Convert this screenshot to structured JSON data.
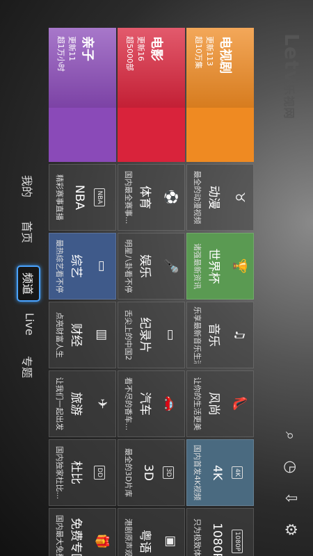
{
  "logo": {
    "text": "Letv",
    "suffix": "乐视网"
  },
  "nav": [
    {
      "label": "我的",
      "active": false
    },
    {
      "label": "首页",
      "active": false
    },
    {
      "label": "频道",
      "active": true
    },
    {
      "label": "Live",
      "active": false
    },
    {
      "label": "专题",
      "active": false
    }
  ],
  "toolbar": {
    "search_icon": "search-icon",
    "history_icon": "clock-icon",
    "download_icon": "download-icon",
    "settings_icon": "gear-icon"
  },
  "featured": [
    {
      "title": "电视剧",
      "sub1": "更新113",
      "sub2": "超10万集",
      "color": "#ef8a22"
    },
    {
      "title": "电影",
      "sub1": "更新16",
      "sub2": "超5000部",
      "color": "#d9233b"
    },
    {
      "title": "亲子",
      "sub1": "更新11",
      "sub2": "超1万小时",
      "color": "#8a4ab8"
    }
  ],
  "channels": [
    {
      "title": "动漫",
      "sub": "最全的动漫视频",
      "icon": "♉",
      "color": ""
    },
    {
      "title": "体育",
      "sub": "国内最全赛事...",
      "icon": "⚽",
      "color": ""
    },
    {
      "title": "NBA",
      "sub": "精彩赛事直播",
      "icon": "NBA",
      "color": ""
    },
    {
      "title": "世界杯",
      "sub": "诸强最新资讯",
      "icon": "🏆",
      "color": "#5a9a52"
    },
    {
      "title": "娱乐",
      "sub": "明星八卦看不停",
      "icon": "🎤",
      "color": ""
    },
    {
      "title": "综艺",
      "sub": "最热综艺看不停",
      "icon": "▭",
      "color": "#3f5a8a"
    },
    {
      "title": "音乐",
      "sub": "乐享最新音乐生活",
      "icon": "♫",
      "color": ""
    },
    {
      "title": "纪录片",
      "sub": "舌尖上的中国2",
      "icon": "▭",
      "color": ""
    },
    {
      "title": "财经",
      "sub": "点亮财富人生",
      "icon": "▥",
      "color": ""
    },
    {
      "title": "风尚",
      "sub": "让你的生活更美",
      "icon": "👠",
      "color": ""
    },
    {
      "title": "汽车",
      "sub": "看不尽的香车...",
      "icon": "🚗",
      "color": ""
    },
    {
      "title": "旅游",
      "sub": "让我们一起出发",
      "icon": "✈",
      "color": ""
    },
    {
      "title": "4K",
      "sub": "国内首发4K视频",
      "icon": "4K",
      "color": "#4a6a80"
    },
    {
      "title": "3D",
      "sub": "最全的3D片库",
      "icon": "3D",
      "color": ""
    },
    {
      "title": "杜比",
      "sub": "国内独家杜比...",
      "icon": "DD",
      "color": ""
    },
    {
      "title": "1080P",
      "sub": "只为极致体验",
      "icon": "1080P",
      "color": ""
    },
    {
      "title": "粤语",
      "sub": "港剧原声观看",
      "icon": "▣",
      "color": ""
    },
    {
      "title": "免费专区",
      "sub": "国内最大免费...",
      "icon": "🎁",
      "color": ""
    }
  ]
}
